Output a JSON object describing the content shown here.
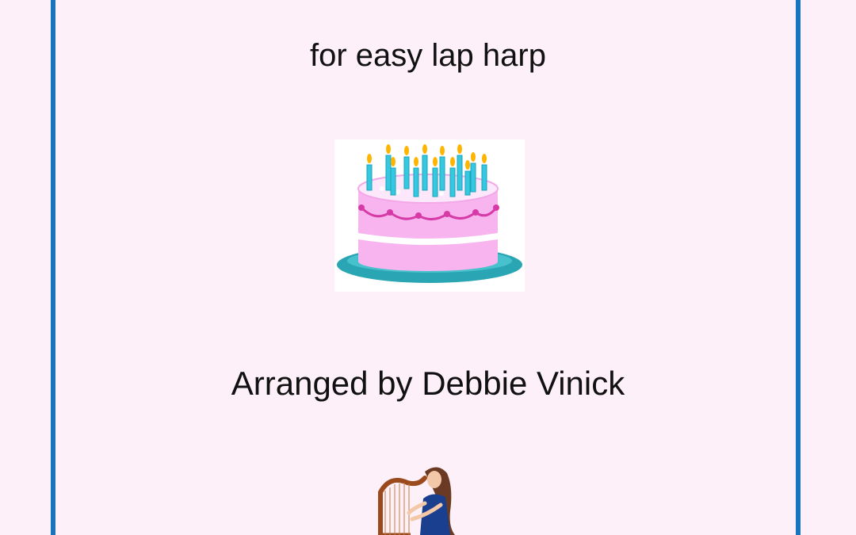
{
  "cover": {
    "subtitle": "for easy lap harp",
    "arranger": "Arranged by Debbie Vinick"
  },
  "illustrations": {
    "cake": "birthday-cake-with-candles",
    "harpist": "woman-playing-harp"
  },
  "colors": {
    "background": "#fdf0f8",
    "border": "#1874be",
    "cake_pink": "#f7b4ee",
    "frosting_trim": "#d63aa6",
    "plate": "#2aa5b3",
    "candle": "#35c8e0",
    "flame": "#ffb400"
  }
}
